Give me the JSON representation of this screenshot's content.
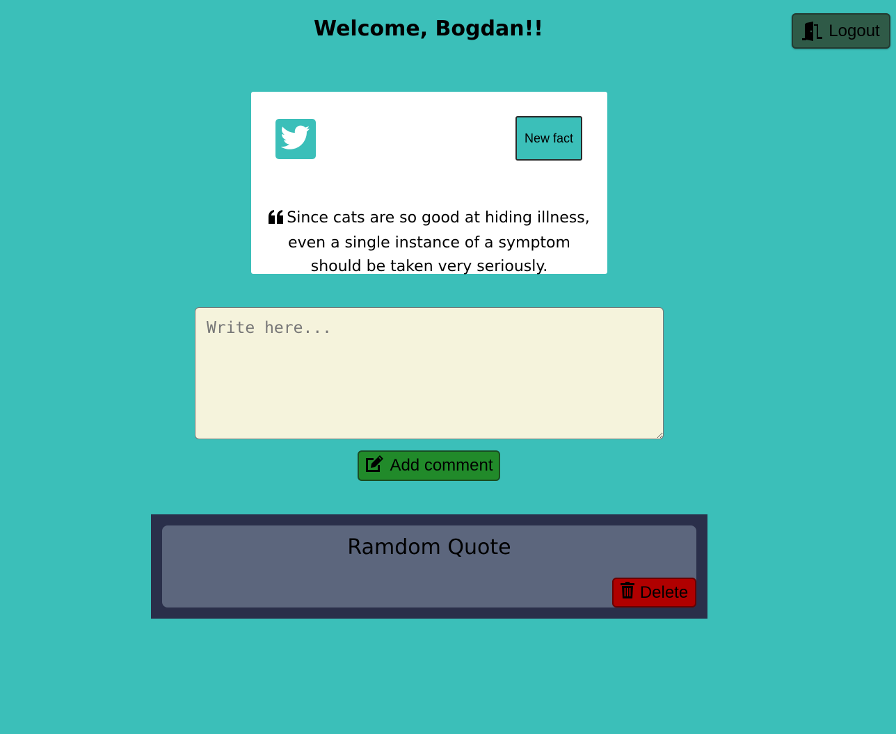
{
  "header": {
    "title": "Welcome, Bogdan!!",
    "logout_label": "Logout"
  },
  "fact_card": {
    "twitter_icon": "twitter-icon",
    "new_fact_label": "New fact",
    "quote_icon": "quote-left-icon",
    "fact_text": "Since cats are so good at hiding illness, even a single instance of a symptom should be taken very seriously."
  },
  "comment_form": {
    "placeholder": "Write here...",
    "value": "",
    "add_comment_label": "Add comment",
    "add_comment_icon": "edit-icon"
  },
  "comments": [
    {
      "text": "Ramdom Quote",
      "delete_label": "Delete",
      "delete_icon": "trash-icon"
    }
  ],
  "colors": {
    "background": "#3bbfb9",
    "logout_button": "#2f5a47",
    "add_comment_button": "#218a2a",
    "delete_button": "#b00000",
    "comments_panel": "#2a2f4a",
    "comment_card": "#5c667d",
    "textarea": "#f5f3dc"
  }
}
